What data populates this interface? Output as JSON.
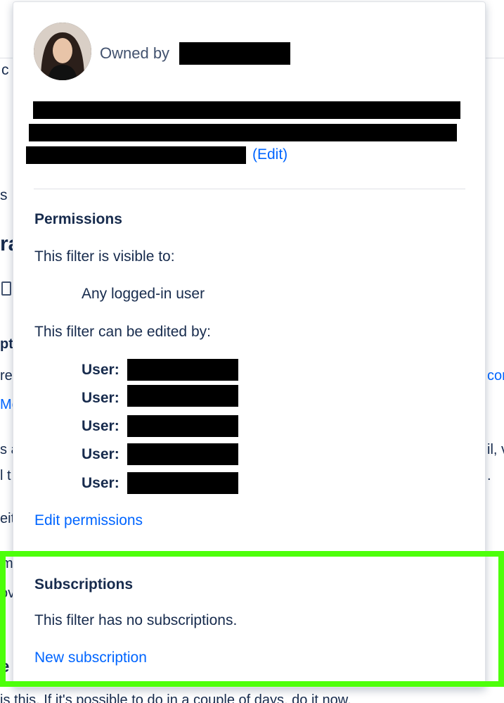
{
  "background": {
    "fragments": [
      "c",
      "s",
      "ra",
      "pt",
      "re",
      "Mc",
      "s a",
      "l t",
      "eit",
      "m",
      "ov",
      "e v",
      "con",
      "il, v",
      "."
    ],
    "bottom_text": "is this.  If it's possible to do in a couple of days, do it now."
  },
  "popover": {
    "owner_prefix": "Owned by",
    "description_edit": "(Edit)",
    "permissions": {
      "heading": "Permissions",
      "visible_to_label": "This filter is visible to:",
      "visible_to_value": "Any logged-in user",
      "edited_by_label": "This filter can be edited by:",
      "users": [
        {
          "label": "User:"
        },
        {
          "label": "User:"
        },
        {
          "label": "User:"
        },
        {
          "label": "User:"
        },
        {
          "label": "User:"
        }
      ],
      "edit_link": "Edit permissions"
    },
    "subscriptions": {
      "heading": "Subscriptions",
      "empty_text": "This filter has no subscriptions.",
      "new_link": "New subscription"
    }
  },
  "colors": {
    "link": "#0065ff",
    "highlight": "#4dff0a",
    "text": "#172b4d"
  }
}
